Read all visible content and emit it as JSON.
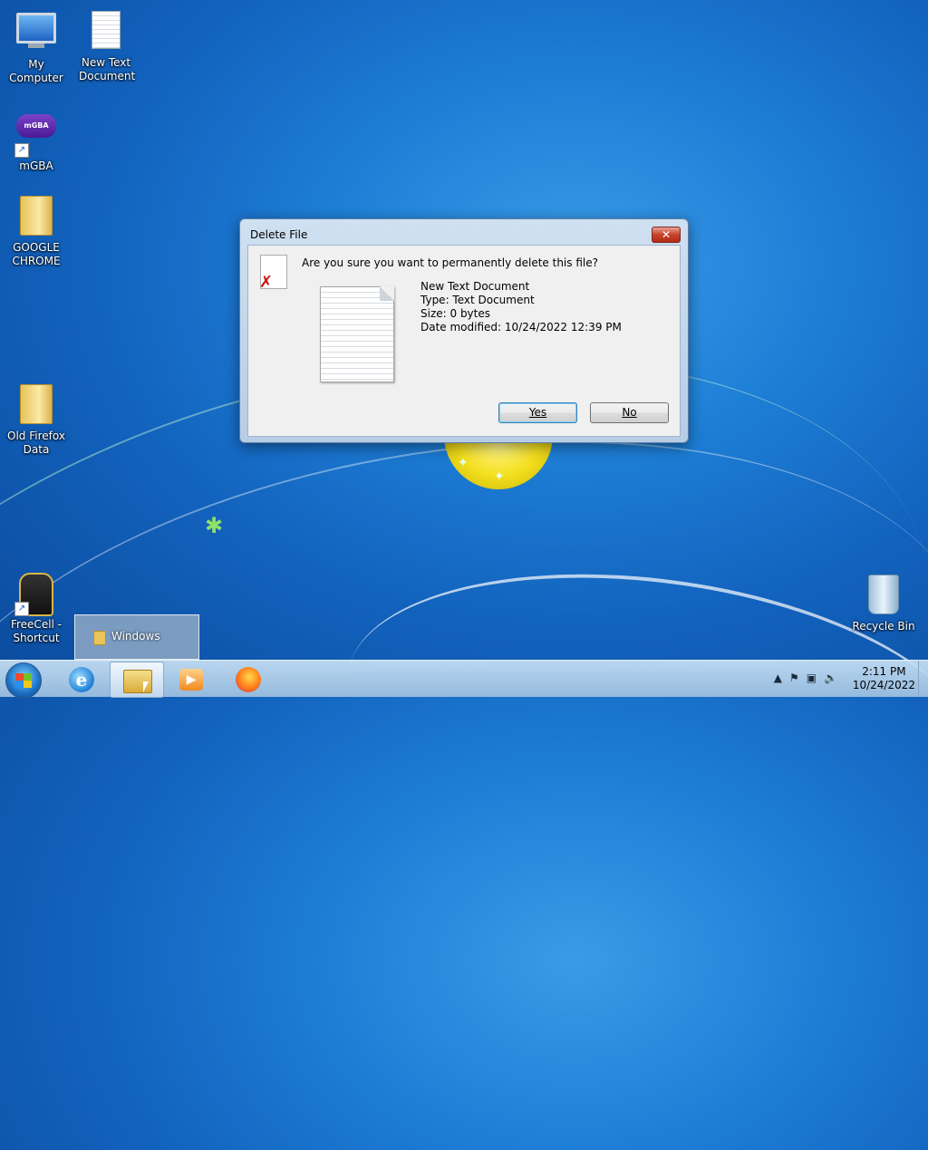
{
  "desktop": {
    "icons": [
      {
        "label": "My Computer",
        "icon": "computer-icon"
      },
      {
        "label": "New Text Document",
        "icon": "text-document-icon"
      },
      {
        "label": "mGBA",
        "icon": "mgba-icon",
        "shortcut": true,
        "badge": "mGBA"
      },
      {
        "label": "GOOGLE CHROME",
        "icon": "folder-icon"
      },
      {
        "label": "Old Firefox Data",
        "icon": "folder-icon"
      },
      {
        "label": "FreeCell - Shortcut",
        "icon": "freecell-icon",
        "shortcut": true
      },
      {
        "label": "Recycle Bin",
        "icon": "recycle-bin-icon"
      }
    ]
  },
  "dialog": {
    "title": "Delete File",
    "close_glyph": "✕",
    "question": "Are you sure you want to permanently delete this file?",
    "file": {
      "name": "New Text Document",
      "type": "Type: Text Document",
      "size": "Size: 0 bytes",
      "modified": "Date modified: 10/24/2022 12:39 PM"
    },
    "buttons": {
      "yes": "Yes",
      "no": "No"
    }
  },
  "taskbar": {
    "popup_label": "Windows",
    "pinned": [
      "internet-explorer-icon",
      "windows-explorer-icon",
      "media-player-icon",
      "firefox-icon"
    ],
    "active_item": "windows-explorer-icon",
    "clock": {
      "time": "2:11 PM",
      "date": "10/24/2022"
    }
  },
  "colors": {
    "accent": "#1e7fd6",
    "close_button": "#c7432d"
  }
}
